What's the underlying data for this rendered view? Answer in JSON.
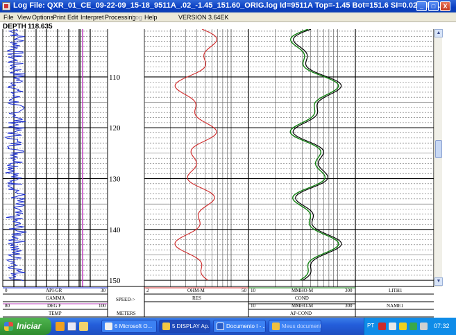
{
  "window": {
    "title": "Log File: QXR_01_CE_09-22-09_15-18_9511A_.02_-1.45_151.60_ORIG.log  Id=9511A   Top=-1.45  Bot=151.6  SI=0.02 DIR=U",
    "minimize_label": "_",
    "maximize_label": "□",
    "close_label": "X"
  },
  "menu": {
    "items": [
      "File",
      "View",
      "Options",
      "Print",
      "Edit",
      "Interpret",
      "Processing",
      "Log",
      "Help"
    ],
    "disabled_item": "Log",
    "version": "VERSION 3.64EK"
  },
  "depth_header": {
    "label": "DEPTH",
    "value": "118.635"
  },
  "depth_axis": {
    "ticks": [
      "110",
      "120",
      "130",
      "140",
      "150"
    ],
    "start": 100.6,
    "end": 150.8
  },
  "tracks": {
    "gamma": {
      "name": "API-GR",
      "min": "0",
      "max": "30",
      "title": "GAMMA",
      "color": "#1a2dd0"
    },
    "temp": {
      "name": "DEG F",
      "min": "80",
      "max": "100",
      "title": "TEMP",
      "color": "#c040c0"
    },
    "speed": {
      "label": "SPEED->",
      "units": "METERS"
    },
    "res": {
      "name": "OHM-M",
      "min": "2",
      "max": "50",
      "title": "RES",
      "color": "#d03030"
    },
    "cond": {
      "name": "MMHO-M",
      "min": "10",
      "max": "300",
      "title": "COND",
      "color": "#108010"
    },
    "apcond": {
      "name": "MMHO-M",
      "min": "10",
      "max": "300",
      "title": "AP-COND",
      "color": "#000000"
    },
    "lith": {
      "name": "LITH1",
      "title": "NAME1"
    }
  },
  "taskbar": {
    "start_label": "Iniciar",
    "tasks": [
      {
        "label": "6 Microsoft O...",
        "active": false
      },
      {
        "label": "5 DISPLAY Ap...",
        "active": true
      },
      {
        "label": "Documento I - ...",
        "active": false
      },
      {
        "label": "Meus documentos",
        "active": false
      }
    ],
    "language": "PT",
    "time": "07:32"
  }
}
